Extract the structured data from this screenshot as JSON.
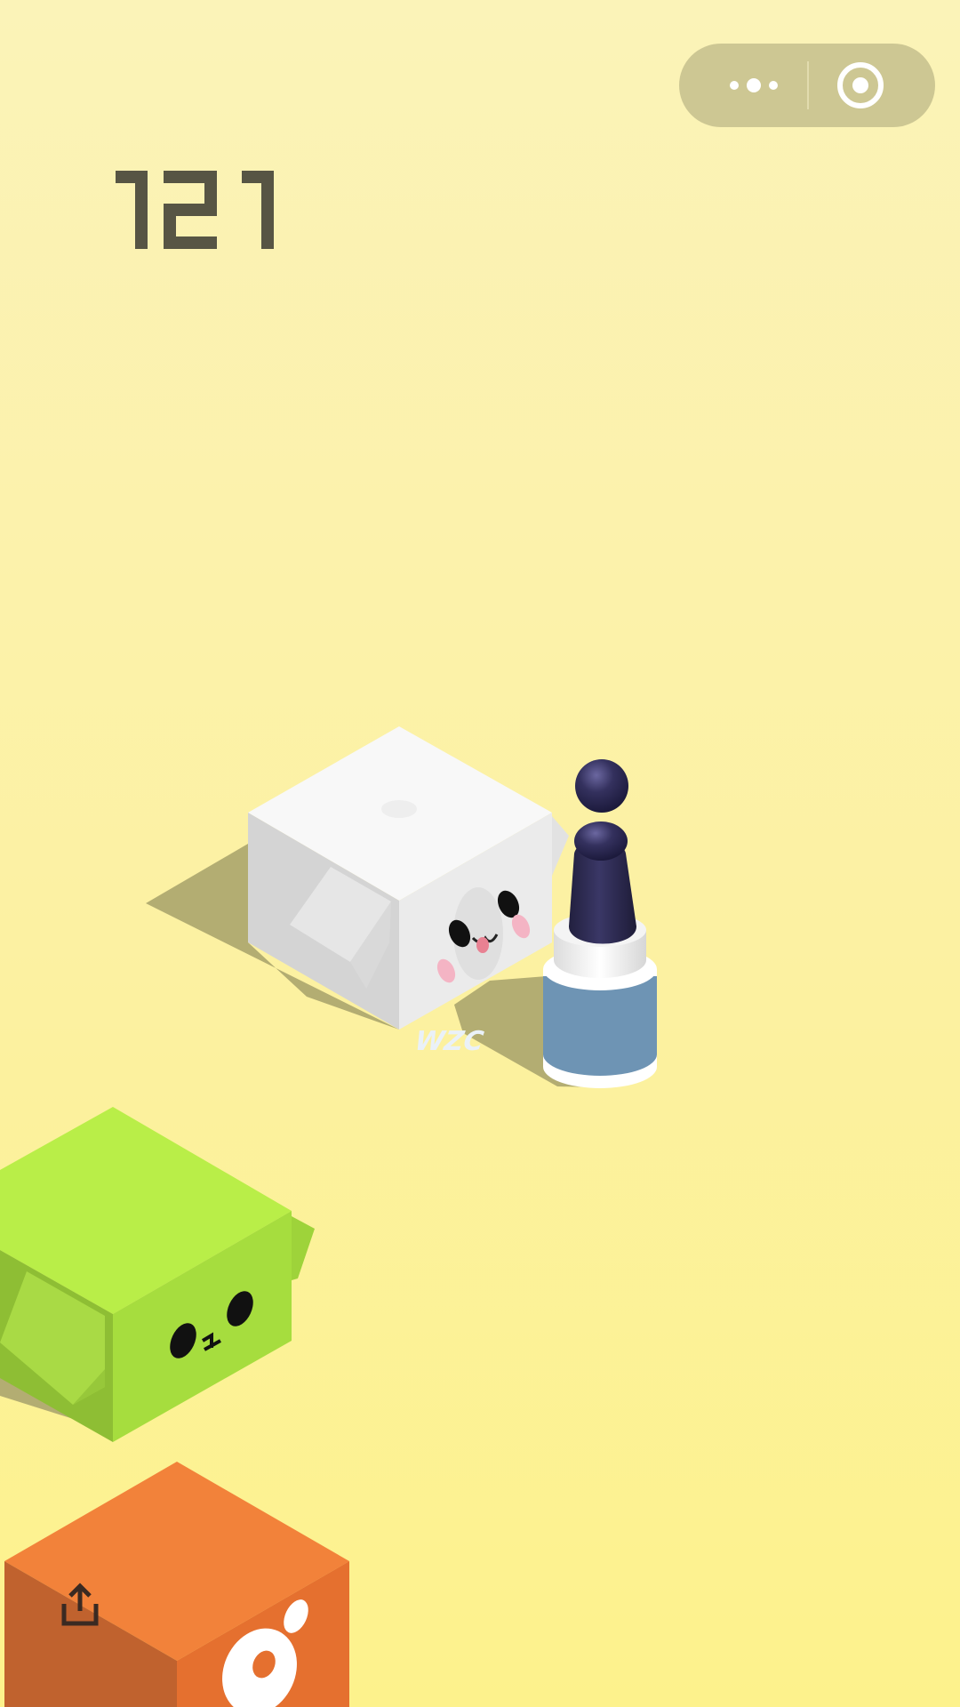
{
  "score": {
    "value": "121"
  },
  "capsule": {
    "more_icon": "more-dots-icon",
    "close_icon": "miniprogram-close-icon"
  },
  "player": {
    "label": "WZC"
  },
  "blocks": [
    {
      "kind": "white-smiley-box"
    },
    {
      "kind": "green-smiley-box"
    },
    {
      "kind": "orange-box"
    }
  ],
  "share": {
    "icon": "share-icon"
  },
  "colors": {
    "background_top": "#FBF3B8",
    "background_bottom": "#FDF28C",
    "capsule": "#CDC793",
    "score": "#575544",
    "player_body": "#2C2A52",
    "player_base": "#6E94B4",
    "white_top": "#F9F9F9",
    "green_top": "#B9EE48",
    "orange_top": "#F2823A"
  }
}
